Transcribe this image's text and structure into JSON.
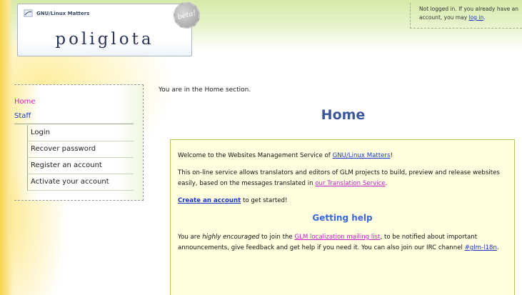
{
  "header": {
    "org_name": "GNU/Linux Matters",
    "site_title": "poliglota",
    "beta_badge": "beta!",
    "login_notice_pre": "Not logged in. If you already have an account, you may ",
    "login_link": "log in",
    "login_notice_post": "."
  },
  "sidebar": {
    "home": "Home",
    "staff": "Staff",
    "items": [
      {
        "label": "Login"
      },
      {
        "label": "Recover password"
      },
      {
        "label": "Register an account"
      },
      {
        "label": "Activate your account"
      }
    ]
  },
  "main": {
    "location": "You are in the Home section.",
    "title": "Home",
    "welcome_pre": "Welcome to the Websites Management Service of ",
    "welcome_link": "GNU/Linux Matters",
    "welcome_post": "!",
    "intro_pre": "This on-line service allows translators and editors of GLM projects to build, preview and release websites easily, based on the messages translated in ",
    "intro_link": "our Translation Service",
    "intro_post": ".",
    "create_link": "Create an account",
    "create_post": " to get started!",
    "help_title": "Getting help",
    "help_pre": "You are ",
    "help_em": "highly encouraged",
    "help_mid": " to join the ",
    "help_link": "GLM localization mailing list",
    "help_post": ", to be notified about important announcements, give feedback and get help if you need it. You can also join our IRC channel ",
    "irc_link": "#glm-l18n",
    "irc_post": "."
  },
  "colors": {
    "link": "#1a37c8",
    "visited_link": "#c020c8",
    "title": "#3a589a",
    "box_background": "#ffffe0"
  }
}
